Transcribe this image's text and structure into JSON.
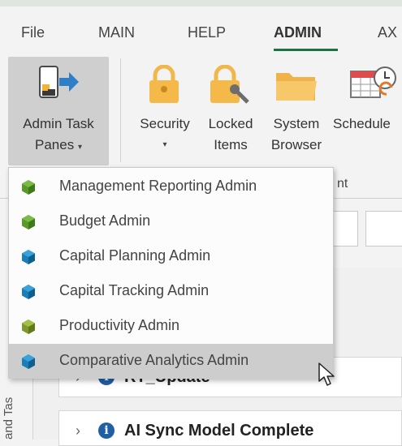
{
  "menu": {
    "items": [
      {
        "label": "File"
      },
      {
        "label": "MAIN"
      },
      {
        "label": "HELP"
      },
      {
        "label": "ADMIN",
        "active": true
      },
      {
        "label": "AX"
      }
    ]
  },
  "ribbon": {
    "admin_task_panes": {
      "line1": "Admin Task",
      "line2": "Panes",
      "caret": "▾"
    },
    "security": {
      "line1": "Security",
      "caret": "▾"
    },
    "locked_items": {
      "line1": "Locked",
      "line2": "Items"
    },
    "system_browser": {
      "line1": "System",
      "line2": "Browser"
    },
    "scheduler": {
      "line1": "Schedule"
    },
    "group_label_fragment": "nt"
  },
  "dropdown": {
    "items": [
      {
        "label": "Management Reporting Admin",
        "icon": "green-cube-icon",
        "color": "#5a9a2a"
      },
      {
        "label": "Budget Admin",
        "icon": "green-cube-icon",
        "color": "#5a9a2a"
      },
      {
        "label": "Capital Planning Admin",
        "icon": "blue-cube-icon",
        "color": "#1a7fb8"
      },
      {
        "label": "Capital Tracking Admin",
        "icon": "blue-cube-icon",
        "color": "#1a7fb8"
      },
      {
        "label": "Productivity Admin",
        "icon": "olive-cube-icon",
        "color": "#7f9a2a"
      },
      {
        "label": "Comparative Analytics Admin",
        "icon": "blue-cube-icon",
        "color": "#1a7fb8",
        "hover": true
      }
    ]
  },
  "left_panel": {
    "text": "and Tas"
  },
  "content": {
    "rows": [
      {
        "label": "RT_Update",
        "info": "i",
        "chevron": "›"
      },
      {
        "label": "AI Sync Model Complete",
        "info": "i",
        "chevron": "›"
      }
    ]
  },
  "colors": {
    "accent": "#1e7145",
    "hover": "#cdcdcd",
    "info_icon": "#1e5fa6"
  }
}
